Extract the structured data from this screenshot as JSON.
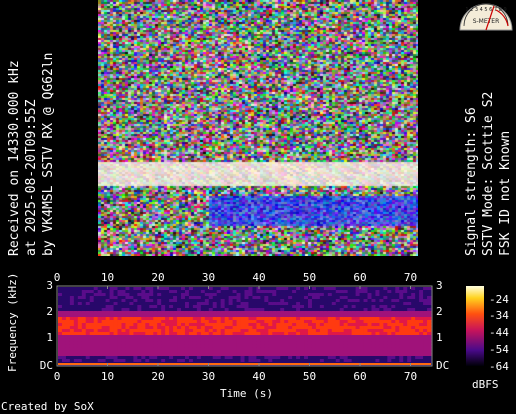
{
  "left_text": {
    "line1": "Received on  14330.000 kHz",
    "line2": "at 2025-08-20T09:55Z",
    "line3": "by VK4MSL SSTV RX @ QG62ln"
  },
  "right_text": {
    "line1": "Signal strength: S6",
    "line2": "SSTV Mode: Scottie S2",
    "line3": "FSK ID not Known"
  },
  "meter": {
    "label": "S-METER",
    "scale": "1 2 3 4 5 6 7 8 9"
  },
  "spectrogram": {
    "ylabel": "Frequency (kHz)",
    "xlabel": "Time (s)",
    "x_ticks": [
      "0",
      "10",
      "20",
      "30",
      "40",
      "50",
      "60",
      "70"
    ],
    "y_ticks_left": [
      "3",
      "2",
      "1",
      "DC"
    ],
    "y_ticks_right": [
      "3",
      "2",
      "1",
      "DC"
    ],
    "colorbar_ticks": [
      "-24",
      "-34",
      "-44",
      "-54",
      "-64"
    ],
    "colorbar_unit": "dBFS"
  },
  "footer": {
    "created_by": "Created by SoX"
  },
  "colors": {
    "background": "#000000",
    "text": "#ffffff",
    "spectro_low": "#1a0a5a",
    "spectro_mid": "#c0146e",
    "spectro_high": "#ff3a10"
  }
}
